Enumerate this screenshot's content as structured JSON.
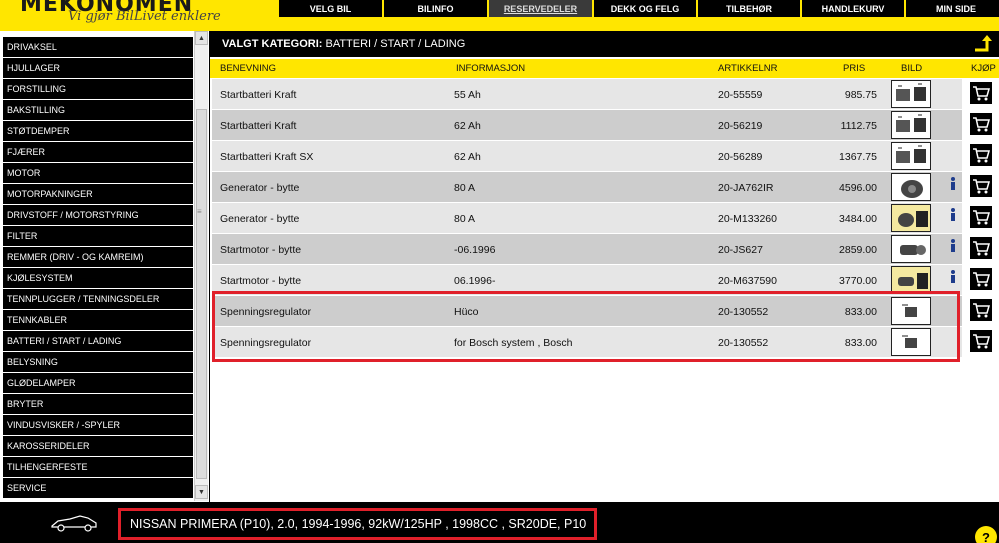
{
  "header": {
    "logo": "MEKONOMEN",
    "tagline": "Vi gjør BilLivet enklere"
  },
  "nav": [
    {
      "label": "VELG BIL"
    },
    {
      "label": "BILINFO"
    },
    {
      "label": "RESERVEDELER"
    },
    {
      "label": "DEKK OG FELG"
    },
    {
      "label": "TILBEHØR"
    },
    {
      "label": "HANDLEKURV"
    },
    {
      "label": "MIN SIDE"
    }
  ],
  "sidebar": {
    "items": [
      "DRIVAKSEL",
      "HJULLAGER",
      "FORSTILLING",
      "BAKSTILLING",
      "STØTDEMPER",
      "FJÆRER",
      "MOTOR",
      "MOTORPAKNINGER",
      "DRIVSTOFF / MOTORSTYRING",
      "FILTER",
      "REMMER (DRIV - OG KAMREIM)",
      "KJØLESYSTEM",
      "TENNPLUGGER / TENNINGSDELER",
      "TENNKABLER",
      "BATTERI / START / LADING",
      "BELYSNING",
      "GLØDELAMPER",
      "BRYTER",
      "VINDUSVISKER / -SPYLER",
      "KAROSSERIDELER",
      "TILHENGERFESTE",
      "SERVICE"
    ]
  },
  "category": {
    "prefix": "VALGT KATEGORI:",
    "name": "BATTERI / START / LADING"
  },
  "table": {
    "headers": {
      "name": "BENEVNING",
      "info": "INFORMASJON",
      "article": "ARTIKKELNR",
      "price": "PRIS",
      "image": "BILD",
      "buy": "KJØP"
    },
    "rows": [
      {
        "name": "Startbatteri Kraft",
        "info": "55 Ah",
        "article": "20-55559",
        "price": "985.75",
        "has_info": false
      },
      {
        "name": "Startbatteri Kraft",
        "info": "62 Ah",
        "article": "20-56219",
        "price": "1112.75",
        "has_info": false
      },
      {
        "name": "Startbatteri Kraft SX",
        "info": "62 Ah",
        "article": "20-56289",
        "price": "1367.75",
        "has_info": false
      },
      {
        "name": "Generator - bytte",
        "info": "80 A",
        "article": "20-JA762IR",
        "price": "4596.00",
        "has_info": true
      },
      {
        "name": "Generator - bytte",
        "info": "80 A",
        "article": "20-M133260",
        "price": "3484.00",
        "has_info": true
      },
      {
        "name": "Startmotor - bytte",
        "info": "-06.1996",
        "article": "20-JS627",
        "price": "2859.00",
        "has_info": true
      },
      {
        "name": "Startmotor - bytte",
        "info": "06.1996-",
        "article": "20-M637590",
        "price": "3770.00",
        "has_info": true
      },
      {
        "name": "Spenningsregulator",
        "info": "Hüco",
        "article": "20-130552",
        "price": "833.00",
        "has_info": false
      },
      {
        "name": "Spenningsregulator",
        "info": "for Bosch system , Bosch",
        "article": "20-130552",
        "price": "833.00",
        "has_info": false
      }
    ]
  },
  "footer": {
    "car": "NISSAN PRIMERA (P10), 2.0, 1994-1996, 92kW/125HP , 1998CC , SR20DE, P10",
    "help": "?"
  },
  "colors": {
    "accent_yellow": "#ffe600",
    "highlight_red": "#e0202a",
    "row_light": "#e6e6e6",
    "row_dark": "#cdcdcd"
  },
  "icons": {
    "cart": "shopping-cart-icon",
    "info": "info-icon",
    "up": "level-up-arrow-icon",
    "car": "car-silhouette-icon"
  }
}
